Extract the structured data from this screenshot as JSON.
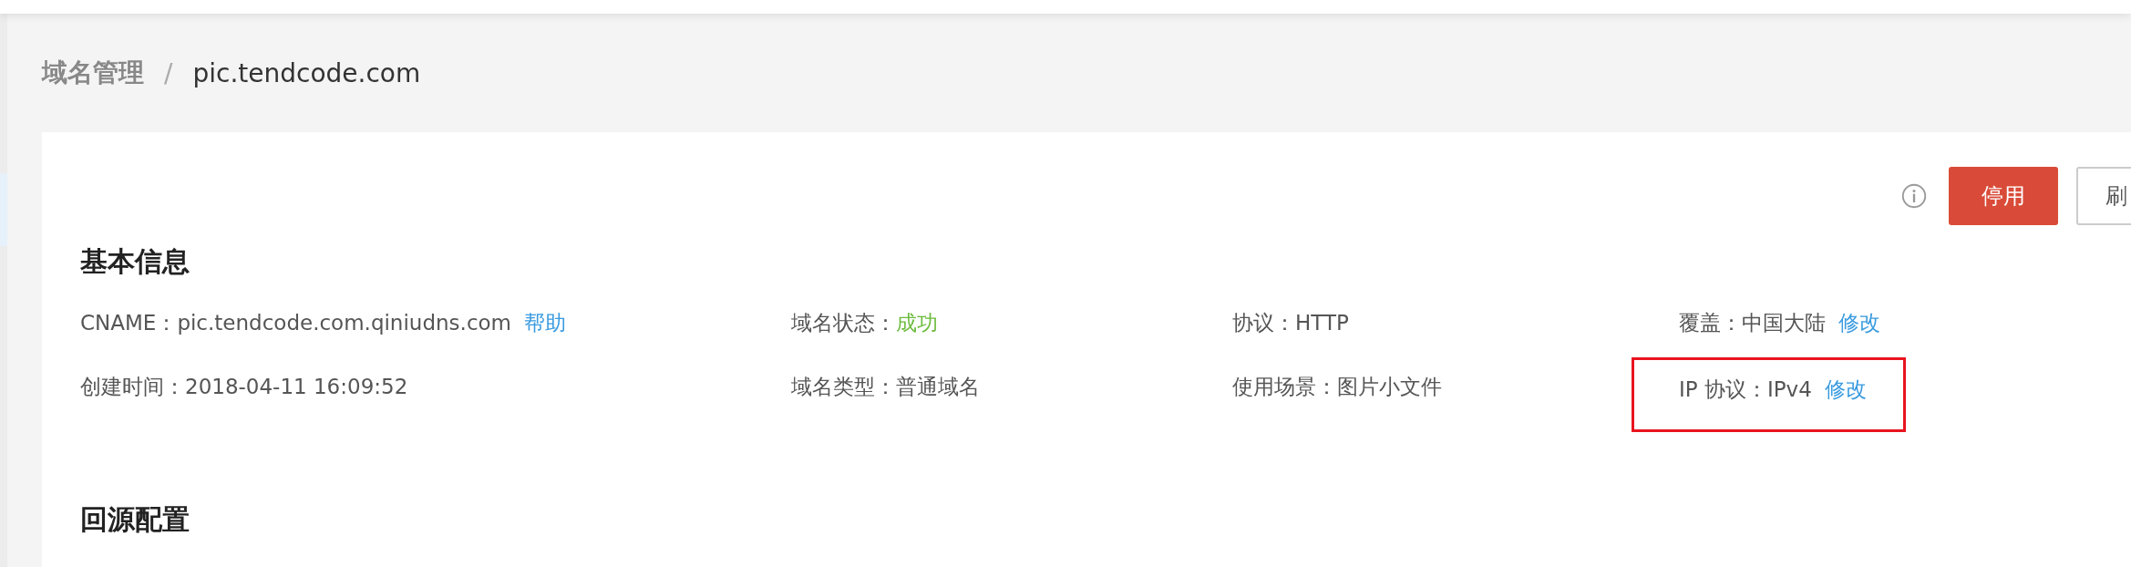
{
  "breadcrumb": [
    {
      "label": "域名管理",
      "selected": false
    },
    {
      "label": "pic.tendcode.com",
      "selected": true
    }
  ],
  "breadcrumb_separator": "/",
  "actions": [
    {
      "label": "停用",
      "kind": "danger"
    },
    {
      "label": "刷",
      "kind": "outline"
    }
  ],
  "section": {
    "title": "基本信息",
    "columns": [
      [
        {
          "label": "CNAME：",
          "value": "pic.tendcode.com.qiniudns.com",
          "link": "帮助",
          "kind": "plain",
          "highlighted": false
        },
        {
          "label": "创建时间：",
          "value": "2018-04-11 16:09:52",
          "kind": "plain",
          "highlighted": false
        }
      ],
      [
        {
          "label": "域名状态：",
          "value": "成功",
          "kind": "success",
          "highlighted": false
        },
        {
          "label": "域名类型：",
          "value": "普通域名",
          "kind": "plain",
          "highlighted": false
        }
      ],
      [
        {
          "label": "协议：",
          "value": "HTTP",
          "kind": "plain",
          "highlighted": false
        },
        {
          "label": "使用场景：",
          "value": "图片小文件",
          "kind": "plain",
          "highlighted": false
        }
      ],
      [
        {
          "label": "覆盖：",
          "value": "中国大陆",
          "link": "修改",
          "kind": "plain",
          "highlighted": false
        },
        {
          "label": "IP 协议：",
          "value": "IPv4",
          "link": "修改",
          "kind": "plain",
          "highlighted": true
        }
      ]
    ]
  },
  "next_section": {
    "title": "回源配置"
  }
}
